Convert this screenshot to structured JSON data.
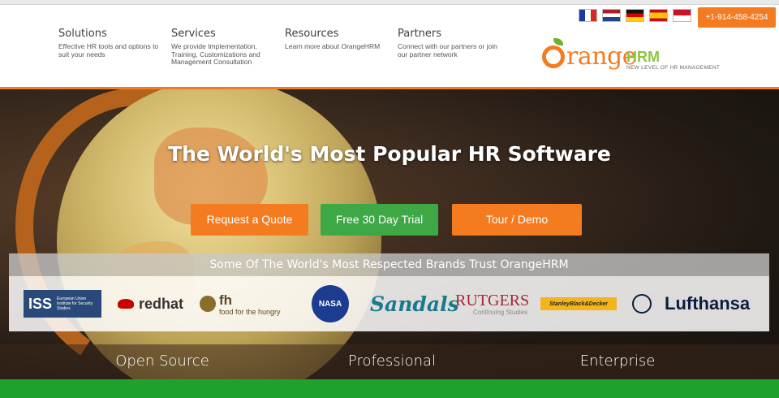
{
  "nav": [
    {
      "title": "Solutions",
      "desc": "Effective HR tools and options to suit your needs"
    },
    {
      "title": "Services",
      "desc": "We provide Implementation, Training, Customizations and Management Consultation"
    },
    {
      "title": "Resources",
      "desc": "Learn more about OrangeHRM"
    },
    {
      "title": "Partners",
      "desc": "Connect with our partners or join our partner network"
    }
  ],
  "flags": [
    "flag-france-icon",
    "flag-netherlands-icon",
    "flag-germany-icon",
    "flag-spain-icon",
    "flag-indonesia-icon"
  ],
  "phone": "+1-914-458-4254",
  "logo": {
    "word": "range",
    "hrm": "HRM",
    "tagline": "NEW LEVEL OF HR MANAGEMENT"
  },
  "hero": {
    "title": "The World's Most Popular HR Software",
    "buttons": {
      "quote": "Request a Quote",
      "trial": "Free 30 Day Trial",
      "demo": "Tour / Demo"
    },
    "brands_heading": "Some Of The World's Most Respected Brands Trust OrangeHRM"
  },
  "brands": {
    "iss": "ISS",
    "iss_sub": "European Union Institute for Security Studies",
    "redhat": "redhat",
    "fh": "fh",
    "fh_sub": "food for the hungry",
    "nasa": "NASA",
    "sandals": "Sandals",
    "rutgers": "RUTGERS",
    "rutgers_sub": "Continuing Studies",
    "sbd": "StanleyBlack&Decker",
    "lufthansa": "Lufthansa"
  },
  "editions": {
    "open_source": "Open Source",
    "professional": "Professional",
    "enterprise": "Enterprise"
  },
  "colors": {
    "orange": "#f47b20",
    "green": "#3da845",
    "footer_green": "#1fa12d"
  }
}
